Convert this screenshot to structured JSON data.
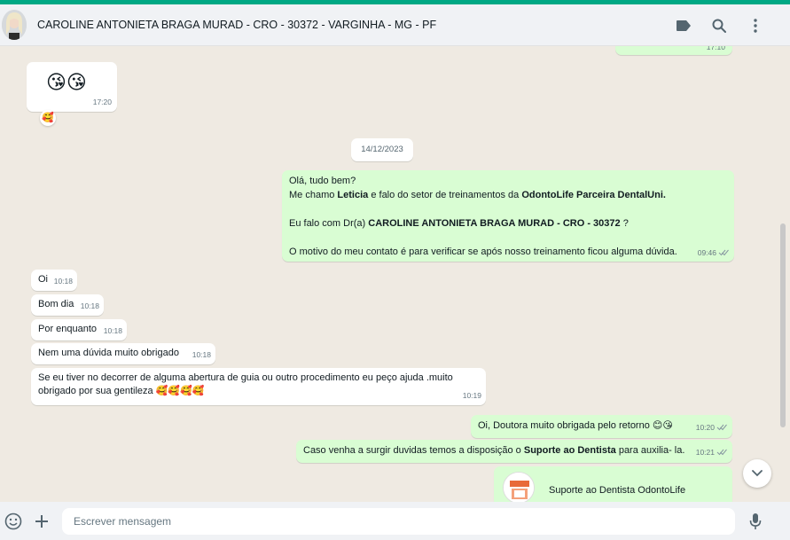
{
  "header": {
    "contact_name": "CAROLINE ANTONIETA BRAGA MURAD - CRO - 30372 - VARGINHA - MG - PF",
    "icons": [
      "label-icon",
      "search-icon",
      "menu-icon"
    ]
  },
  "chat": {
    "top_partial_time": "17:10",
    "messages": {
      "emoji_msg": {
        "text": "😘😘",
        "time": "17:20",
        "reaction": "🥰"
      },
      "date_divider": "14/12/2023",
      "intro": {
        "line1": "Olá, tudo bem?",
        "line2_pre": "Me chamo ",
        "line2_name": "Leticia",
        "line2_mid": " e falo do setor de treinamentos  da ",
        "line2_company": "OdontoLife Parceira DentalUni.",
        "line3_pre": " Eu falo com Dr(a) ",
        "line3_name": "CAROLINE ANTONIETA BRAGA MURAD - CRO - 30372",
        "line3_post": " ?",
        "line4": "O motivo do meu contato é para verificar se após nosso treinamento ficou alguma dúvida.",
        "time": "09:46"
      },
      "m_oi": {
        "text": "Oi",
        "time": "10:18"
      },
      "m_bomdia": {
        "text": "Bom dia",
        "time": "10:18"
      },
      "m_porenquanto": {
        "text": "Por enquanto",
        "time": "10:18"
      },
      "m_nemuma": {
        "text": "Nem uma dúvida muito obrigado",
        "time": "10:18"
      },
      "m_seeu": {
        "text1": "Se eu tiver no decorrer  de alguma abertura de guia ou outro procedimento eu peço ajuda .muito",
        "text2": "obrigado por sua gentileza 🥰🥰🥰🥰",
        "time": "10:19"
      },
      "m_oidoutora": {
        "text": "Oi, Doutora muito obrigada pelo retorno 😊😘",
        "time": "10:20"
      },
      "m_casovenha": {
        "pre": "Caso venha a surgir duvidas temos a disposição o ",
        "bold": "Suporte ao Dentista",
        "post": " para auxilia- la.",
        "time": "10:21"
      },
      "m_doc": {
        "title": "Suporte ao Dentista OdontoLife"
      }
    }
  },
  "footer": {
    "placeholder": "Escrever mensagem",
    "value": "",
    "icons": [
      "emoji-icon",
      "plus-icon",
      "mic-icon"
    ]
  },
  "colors": {
    "accent": "#00a884",
    "incoming": "#ffffff",
    "outgoing": "#d9fdd3",
    "background": "#efeae2"
  }
}
